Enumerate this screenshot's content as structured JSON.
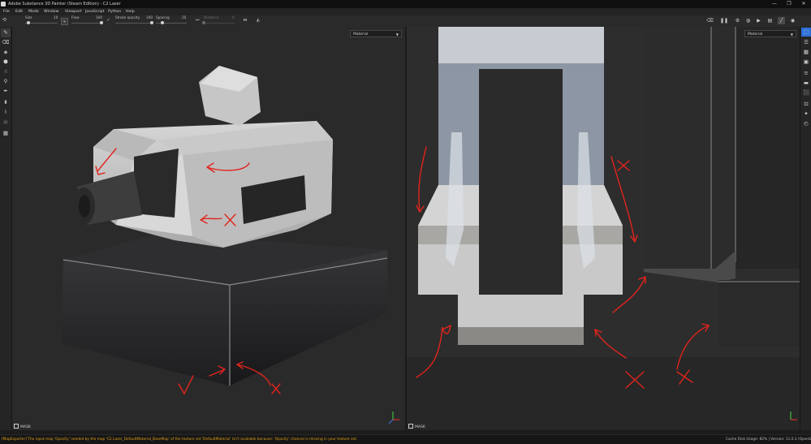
{
  "window": {
    "title": "Adobe Substance 3D Painter (Steam Edition) - C2 Laser",
    "minimize_glyph": "—",
    "restore_glyph": "❐",
    "close_glyph": "✕"
  },
  "menu": {
    "items": [
      "File",
      "Edit",
      "Mode",
      "Window",
      "Viewport",
      "JavaScript",
      "Python",
      "Help"
    ]
  },
  "toolbar": {
    "size_label": "Size",
    "size_value": "10",
    "size_fraction": 0.1,
    "flow_label": "Flow",
    "flow_value": "100",
    "flow_fraction": 1.0,
    "stroke_opacity_label": "Stroke opacity",
    "stroke_opacity_value": "100",
    "stroke_opacity_fraction": 1.0,
    "spacing_label": "Spacing",
    "spacing_value": "20",
    "spacing_fraction": 0.2,
    "distance_label": "Distance",
    "distance_value": "0",
    "distance_fraction": 0.0
  },
  "viewports": {
    "left_channel": "Material",
    "right_channel": "Material",
    "left_mask_label": "MASK",
    "right_mask_label": "MASK"
  },
  "status": {
    "message": "[MapExporter] The input map 'Opacity' needed by the map 'C2 Laser_DefaultMaterial_BaseMap' of the texture set 'DefaultMaterial' isn't available because: 'Opacity' channel is missing in your texture set.",
    "cache": "Cache Disk Usage:   82% | Version: 11.0.3 (OpenGL)"
  },
  "colors": {
    "annotation_red": "#e0241d",
    "warning_text": "#e0a018"
  }
}
